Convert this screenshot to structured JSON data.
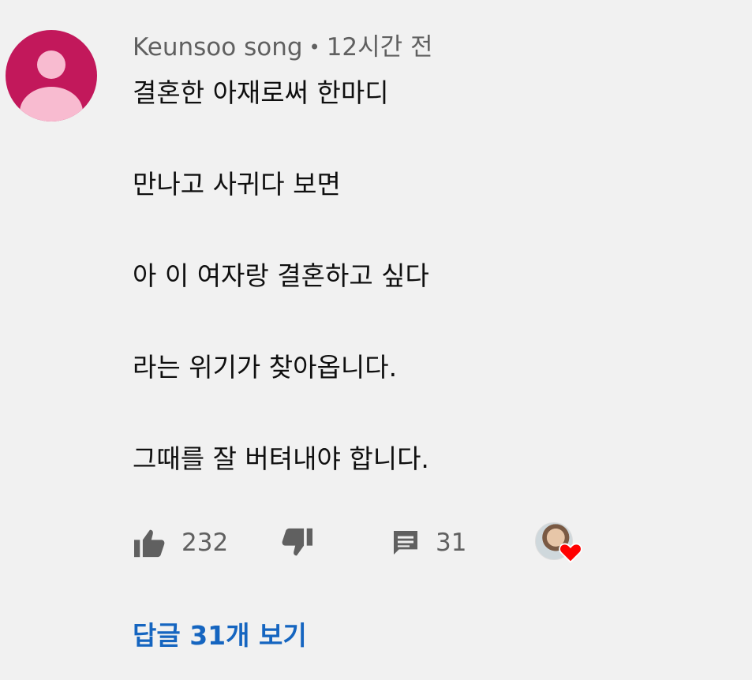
{
  "comment": {
    "author": "Keunsoo song",
    "separator": "•",
    "time": "12시간 전",
    "lines": [
      "결혼한 아재로써 한마디",
      "만나고 사귀다 보면",
      "아 이 여자랑 결혼하고 싶다",
      "라는 위기가 찾아옵니다.",
      "그때를 잘 버텨내야 합니다."
    ],
    "like_count": "232",
    "reply_count": "31",
    "view_replies_label": "답글 31개 보기"
  },
  "icons": {
    "avatar": "default-avatar-icon",
    "like": "thumbs-up-icon",
    "dislike": "thumbs-down-icon",
    "reply": "comment-icon",
    "creator_heart": "heart-icon"
  },
  "colors": {
    "background": "#f1f1f1",
    "avatar_bg": "#c2185b",
    "avatar_figure": "#f8bbd0",
    "link": "#1565c0",
    "heart": "#ff0000",
    "secondary_text": "#606060"
  }
}
